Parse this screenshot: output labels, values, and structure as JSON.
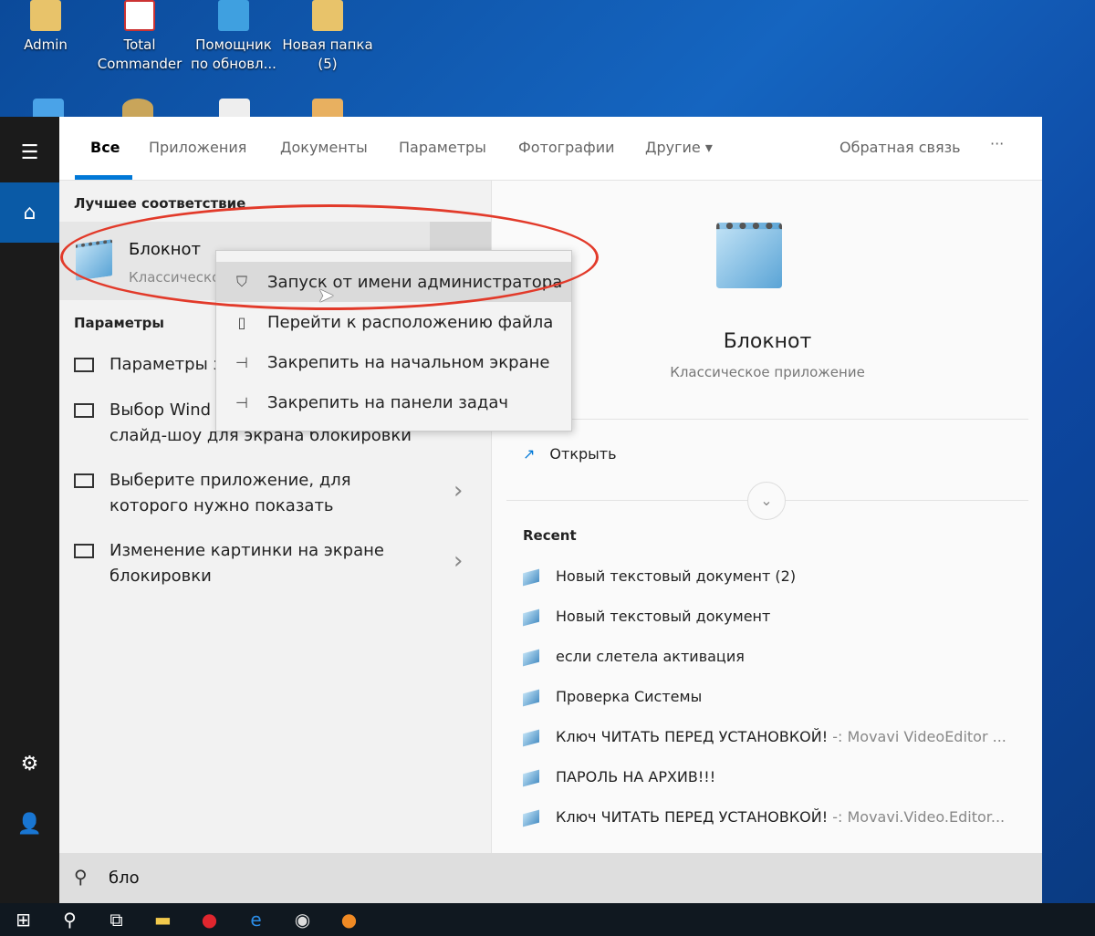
{
  "desktop": {
    "icons": [
      {
        "label": "Admin"
      },
      {
        "label": "Total Commander"
      },
      {
        "label": "Помощник по обновл..."
      },
      {
        "label": "Новая папка (5)"
      }
    ]
  },
  "sidebar": {
    "items": [
      {
        "icon": "hamburger-menu-icon"
      },
      {
        "icon": "home-icon"
      },
      {
        "icon": "gear-icon"
      },
      {
        "icon": "user-icon"
      }
    ]
  },
  "tabs": {
    "items": [
      {
        "label": "Все",
        "active": true
      },
      {
        "label": "Приложения"
      },
      {
        "label": "Документы"
      },
      {
        "label": "Параметры"
      },
      {
        "label": "Фотографии"
      },
      {
        "label": "Другие"
      }
    ],
    "feedback": "Обратная связь",
    "more": "···"
  },
  "left": {
    "best_match_header": "Лучшее соответствие",
    "best": {
      "title": "Блокнот",
      "subtitle": "Классическо"
    },
    "settings_header": "Параметры",
    "settings": [
      {
        "label": "Параметры з"
      },
      {
        "label1": "Выбор Wind",
        "label2": "слайд-шоу для экрана блокировки"
      },
      {
        "label1": "Выберите приложение, для",
        "label2": "которого нужно показать"
      },
      {
        "label1": "Изменение картинки на экране",
        "label2": "блокировки"
      }
    ]
  },
  "context_menu": {
    "items": [
      {
        "label": "Запуск от имени администратора",
        "icon": "admin-shield-icon"
      },
      {
        "label": "Перейти к расположению файла",
        "icon": "folder-location-icon"
      },
      {
        "label": "Закрепить на начальном экране",
        "icon": "pin-icon"
      },
      {
        "label": "Закрепить на панели задач",
        "icon": "pin-icon"
      }
    ]
  },
  "right": {
    "app_title": "Блокнот",
    "app_subtitle": "Классическое приложение",
    "open": "Открыть",
    "recent_header": "Recent",
    "recent": [
      {
        "name": "Новый текстовый документ (2)",
        "sub": ""
      },
      {
        "name": "Новый текстовый документ",
        "sub": ""
      },
      {
        "name": "если слетела активация",
        "sub": ""
      },
      {
        "name": "Проверка Системы",
        "sub": ""
      },
      {
        "name": "Ключ ЧИТАТЬ ПЕРЕД УСТАНОВКОЙ!",
        "sub": " -: Movavi VideoEditor ..."
      },
      {
        "name": "ПАРОЛЬ НА АРХИВ!!!",
        "sub": ""
      },
      {
        "name": "Ключ ЧИТАТЬ ПЕРЕД УСТАНОВКОЙ!",
        "sub": " -: Movavi.Video.Editor..."
      }
    ]
  },
  "search": {
    "value": "бло"
  },
  "colors": {
    "accent": "#0078d7",
    "annotation": "#e23a2a"
  }
}
